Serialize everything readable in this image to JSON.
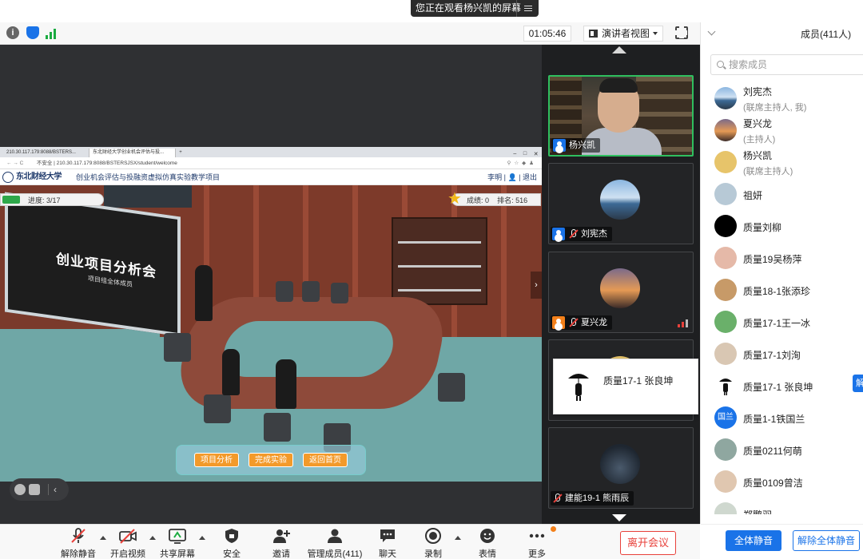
{
  "banner": {
    "text": "您正在观看杨兴凯的屏幕"
  },
  "topbar": {
    "timer": "01:05:46",
    "view_label": "演讲者视图"
  },
  "shared_screen": {
    "tabs": [
      "210.30.117.179:8088/BSTERS...",
      "东北财经大学创业机会评估与投..."
    ],
    "url_prefix": "不安全",
    "url": "210.30.117.179:8088/BSTERSJSX/student/welcome",
    "univ_name": "东北财经大学",
    "site_title": "创业机会评估与投融资虚拟仿真实验教学项目",
    "site_user": "李明 | 👤 | 退出",
    "progress_label": "进度:",
    "progress_value": "3/17",
    "progress_fraction": 0.176,
    "score_label": "成绩:",
    "score_value": "0",
    "rank_label": "排名:",
    "rank_value": "516",
    "board_title": "创业项目分析会",
    "board_subtitle": "项目组全体成员",
    "buttons": [
      "项目分析",
      "完成实验",
      "返回首页"
    ]
  },
  "video_tiles": [
    {
      "name": "杨兴凯",
      "type": "camera"
    },
    {
      "name": "刘宪杰",
      "type": "avatar"
    },
    {
      "name": "夏兴龙",
      "type": "avatar"
    },
    {
      "name": "建能19-1 熊雨辰",
      "type": "avatar"
    }
  ],
  "hover_card": {
    "name": "质量17-1 张良坤"
  },
  "panel": {
    "title": "成员(411人)",
    "search_placeholder": "搜索成员",
    "members": [
      {
        "name": "刘宪杰",
        "role": "(联席主持人, 我)",
        "avatar_color": "#5a8fc4"
      },
      {
        "name": "夏兴龙",
        "role": "(主持人)",
        "avatar_color": "#d9844a"
      },
      {
        "name": "杨兴凯",
        "role": "(联席主持人)",
        "avatar_color": "#e7c46a"
      },
      {
        "name": "祖妍",
        "role": "",
        "avatar_color": "#b7c9d6"
      },
      {
        "name": "质量刘柳",
        "role": "",
        "avatar_color": "#000000"
      },
      {
        "name": "质量19吴杨萍",
        "role": "",
        "avatar_color": "#e5b9a8"
      },
      {
        "name": "质量18-1张添珍",
        "role": "",
        "avatar_color": "#c79a68"
      },
      {
        "name": "质量17-1王一冰",
        "role": "",
        "avatar_color": "#6ab06a"
      },
      {
        "name": "质量17-1刘洵",
        "role": "",
        "avatar_color": "#d9c7b3"
      },
      {
        "name": "质量17-1 张良坤",
        "role": "",
        "avatar_color": "#ffffff"
      },
      {
        "name": "质量1-1铁国兰",
        "role": "",
        "avatar_color": "#1a73e8",
        "avatar_text": "国兰"
      },
      {
        "name": "质量0211何萌",
        "role": "",
        "avatar_color": "#8fa7a0"
      },
      {
        "name": "质量0109曾洁",
        "role": "",
        "avatar_color": "#e0c7b0"
      },
      {
        "name": "郑鹏羽",
        "role": "",
        "avatar_color": "#cfd8cf"
      }
    ],
    "mute_all": "全体静音",
    "unmute_all": "解除全体静音",
    "cut_btn": "解"
  },
  "bottombar": {
    "items": [
      {
        "label": "解除静音",
        "icon": "mic-off-icon"
      },
      {
        "label": "开启视频",
        "icon": "camera-off-icon"
      },
      {
        "label": "共享屏幕",
        "icon": "share-screen-icon"
      },
      {
        "label": "安全",
        "icon": "shield-icon"
      },
      {
        "label": "邀请",
        "icon": "invite-icon"
      },
      {
        "label": "管理成员(411)",
        "icon": "members-icon"
      },
      {
        "label": "聊天",
        "icon": "chat-icon"
      },
      {
        "label": "录制",
        "icon": "record-icon"
      },
      {
        "label": "表情",
        "icon": "emoji-icon"
      },
      {
        "label": "更多",
        "icon": "more-icon"
      }
    ],
    "leave": "离开会议"
  }
}
